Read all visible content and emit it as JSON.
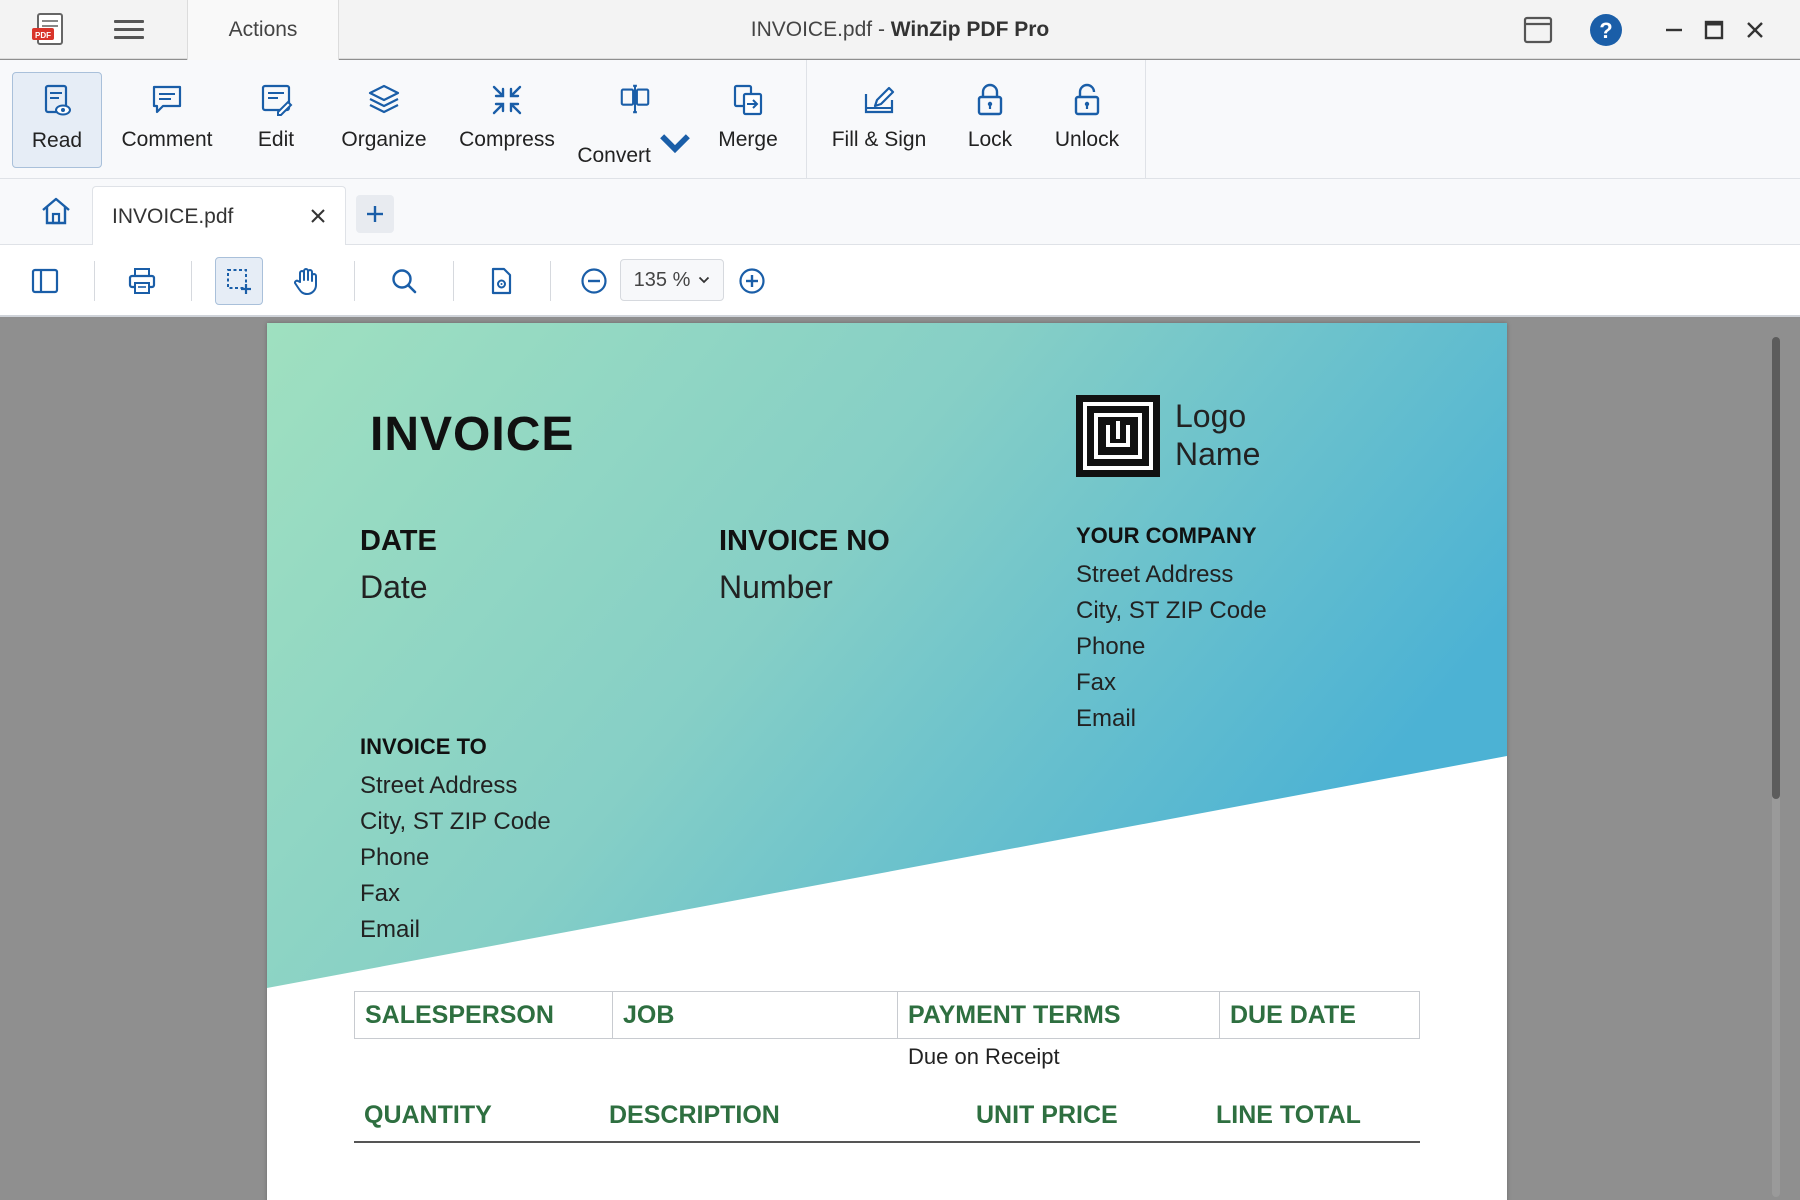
{
  "window": {
    "doc_name": "INVOICE.pdf",
    "separator": " - ",
    "app_name": "WinZip PDF Pro"
  },
  "titlebar": {
    "actions_tab": "Actions"
  },
  "ribbon": {
    "read": "Read",
    "comment": "Comment",
    "edit": "Edit",
    "organize": "Organize",
    "compress": "Compress",
    "convert": "Convert",
    "merge": "Merge",
    "fill_sign": "Fill & Sign",
    "lock": "Lock",
    "unlock": "Unlock"
  },
  "tabs": {
    "document": "INVOICE.pdf"
  },
  "toolbar": {
    "zoom": "135 %"
  },
  "colors": {
    "accent_blue": "#1a5ea8",
    "gradient_start": "#9fe0c0",
    "gradient_end": "#4cb2d4",
    "table_header_green": "#2e6f40"
  },
  "invoice": {
    "title": "INVOICE",
    "date_label": "DATE",
    "date_value": "Date",
    "invoice_no_label": "INVOICE NO",
    "invoice_no_value": "Number",
    "logo_line1": "Logo",
    "logo_line2": "Name",
    "company_label": "YOUR COMPANY",
    "company_lines": [
      "Street Address",
      "City, ST ZIP Code",
      "Phone",
      "Fax",
      "Email"
    ],
    "invoice_to_label": "INVOICE TO",
    "invoice_to_lines": [
      "Street Address",
      "City, ST ZIP Code",
      "Phone",
      "Fax",
      "Email"
    ],
    "summary_headers": [
      "SALESPERSON",
      "JOB",
      "PAYMENT TERMS",
      "DUE DATE"
    ],
    "payment_terms_value": "Due on Receipt",
    "item_headers": [
      "QUANTITY",
      "DESCRIPTION",
      "UNIT PRICE",
      "LINE TOTAL"
    ]
  }
}
